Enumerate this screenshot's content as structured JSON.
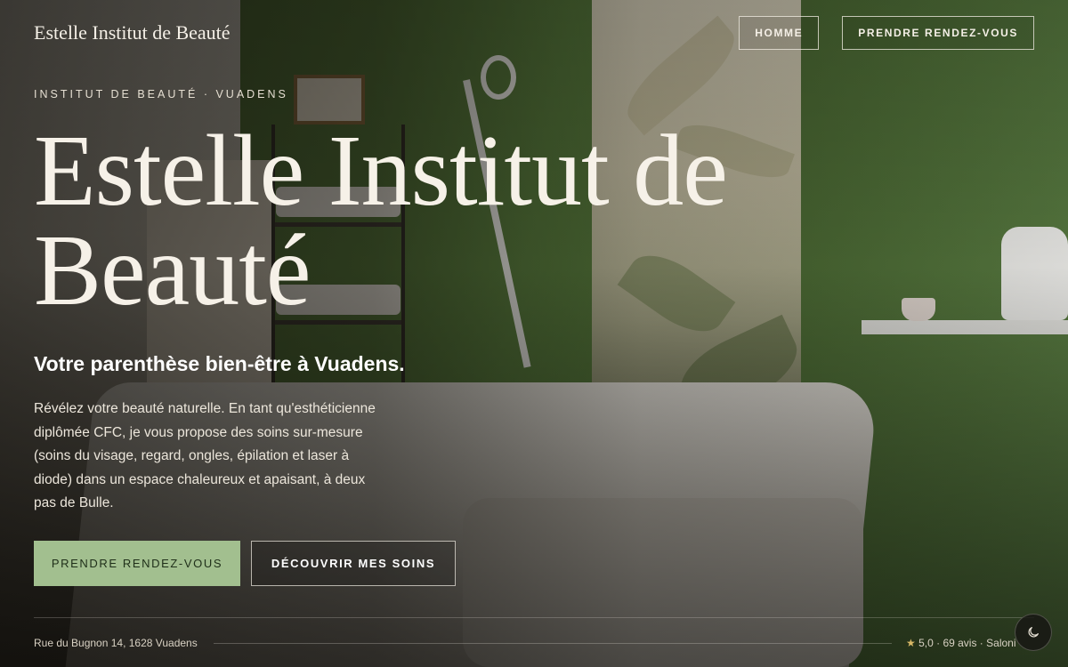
{
  "header": {
    "brand": "Estelle Institut de Beauté",
    "nav": [
      {
        "label": "HOMME"
      },
      {
        "label": "PRENDRE RENDEZ-VOUS"
      }
    ]
  },
  "hero": {
    "eyebrow": "INSTITUT DE BEAUTÉ · VUADENS",
    "title_line1": "Estelle Institut de",
    "title_line2": "Beauté",
    "subtitle": "Votre parenthèse bien-être à Vuadens.",
    "description": "Révélez votre beauté naturelle. En tant qu'esthéticienne diplômée CFC, je vous propose des soins sur-mesure (soins du visage, regard, ongles, épilation et laser à diode) dans un espace chaleureux et apaisant, à deux pas de Bulle.",
    "cta_primary": "PRENDRE RENDEZ-VOUS",
    "cta_secondary": "DÉCOUVRIR MES SOINS"
  },
  "footer": {
    "address": "Rue du Bugnon 14, 1628 Vuadens",
    "rating_star": "★",
    "rating_text": "5,0 · 69 avis · Saloni"
  },
  "icons": {
    "theme_toggle": "moon-icon"
  },
  "colors": {
    "accent_green": "#a2bf8f",
    "text_cream": "#f4efe6",
    "star_gold": "#d8b866"
  }
}
